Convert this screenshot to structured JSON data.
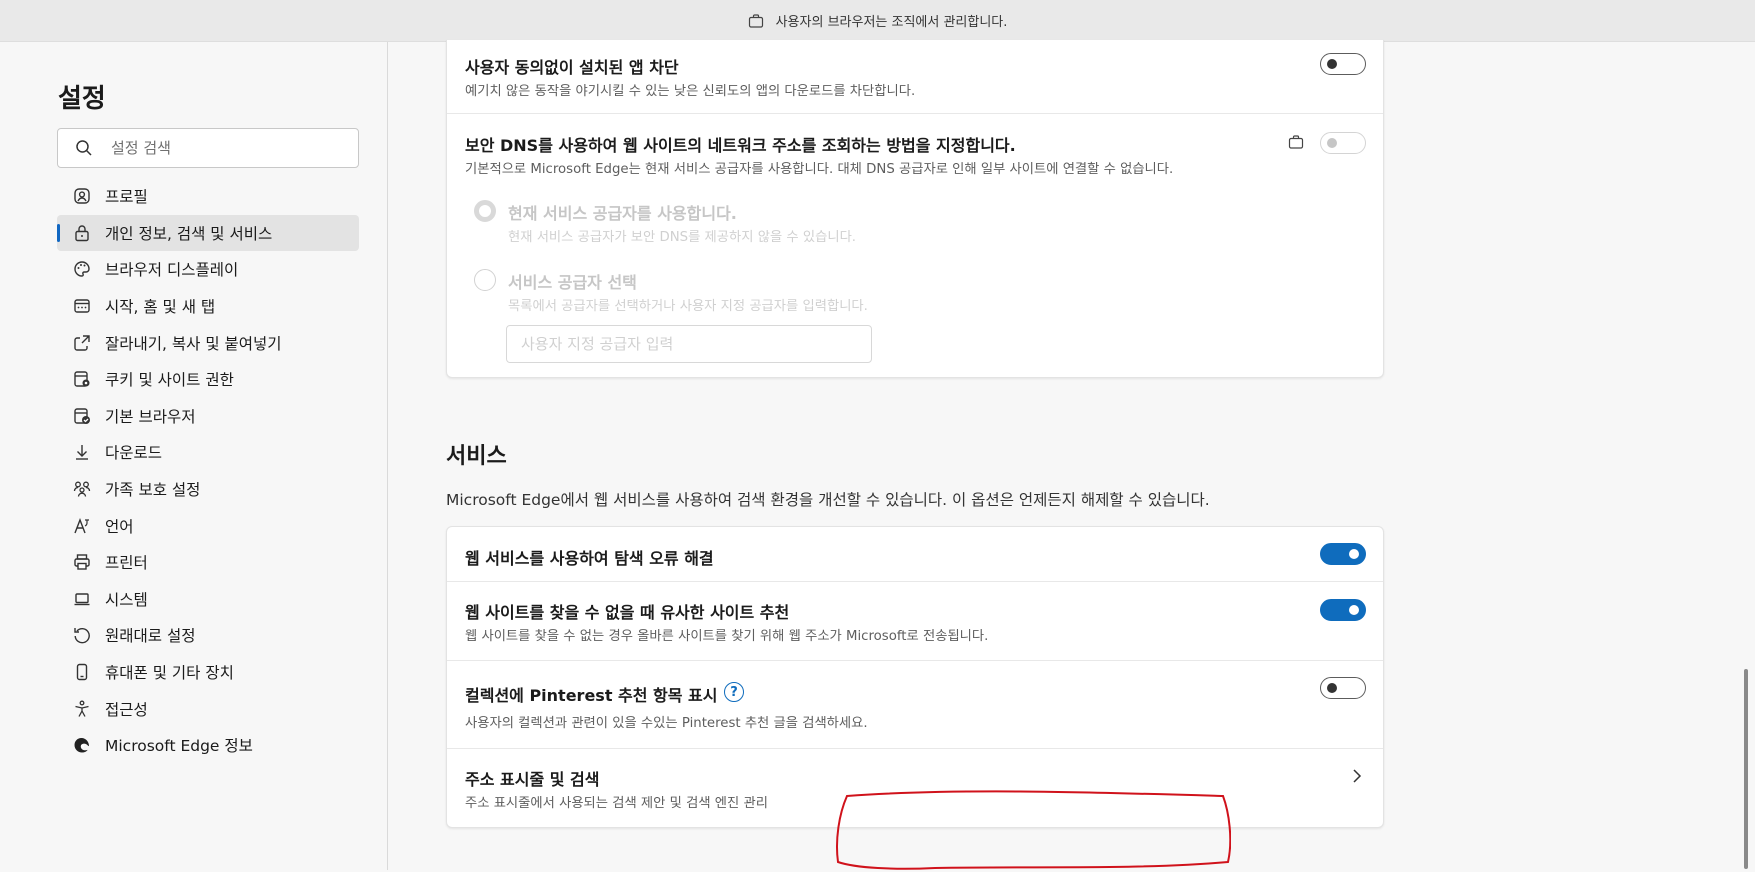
{
  "banner": {
    "text": "사용자의 브라우저는 조직에서 관리합니다.",
    "icon": "briefcase-icon"
  },
  "sidebar": {
    "title": "설정",
    "search_placeholder": "설정 검색",
    "items": [
      {
        "label": "프로필",
        "icon": "profile-icon",
        "active": false
      },
      {
        "label": "개인 정보, 검색 및 서비스",
        "icon": "lock-icon",
        "active": true
      },
      {
        "label": "브라우저 디스플레이",
        "icon": "palette-icon",
        "active": false
      },
      {
        "label": "시작, 홈 및 새 탭",
        "icon": "home-tab-icon",
        "active": false
      },
      {
        "label": "잘라내기, 복사 및 붙여넣기",
        "icon": "share-icon",
        "active": false
      },
      {
        "label": "쿠키 및 사이트 권한",
        "icon": "cookie-site-icon",
        "active": false
      },
      {
        "label": "기본 브라우저",
        "icon": "default-browser-icon",
        "active": false
      },
      {
        "label": "다운로드",
        "icon": "download-icon",
        "active": false
      },
      {
        "label": "가족 보호 설정",
        "icon": "family-icon",
        "active": false
      },
      {
        "label": "언어",
        "icon": "language-icon",
        "active": false
      },
      {
        "label": "프린터",
        "icon": "printer-icon",
        "active": false
      },
      {
        "label": "시스템",
        "icon": "laptop-icon",
        "active": false
      },
      {
        "label": "원래대로 설정",
        "icon": "reset-icon",
        "active": false
      },
      {
        "label": "휴대폰 및 기타 장치",
        "icon": "phone-icon",
        "active": false
      },
      {
        "label": "접근성",
        "icon": "accessibility-icon",
        "active": false
      },
      {
        "label": "Microsoft Edge 정보",
        "icon": "edge-logo-icon",
        "active": false
      }
    ]
  },
  "security": {
    "pua": {
      "title": "사용자 동의없이 설치된 앱 차단",
      "desc": "예기치 않은 동작을 야기시킬 수 있는 낮은 신뢰도의 앱의 다운로드를 차단합니다.",
      "toggle": "off"
    },
    "dns": {
      "title": "보안 DNS를 사용하여 웹 사이트의 네트워크 주소를 조회하는 방법을 지정합니다.",
      "desc": "기본적으로 Microsoft Edge는 현재 서비스 공급자를 사용합니다. 대체 DNS 공급자로 인해 일부 사이트에 연결할 수 없습니다.",
      "toggle": "off-disabled",
      "managed_icon": "briefcase-icon",
      "option_current": {
        "title": "현재 서비스 공급자를 사용합니다.",
        "desc": "현재 서비스 공급자가 보안 DNS를 제공하지 않을 수 있습니다.",
        "checked": true
      },
      "option_choose": {
        "title": "서비스 공급자 선택",
        "desc": "목록에서 공급자를 선택하거나 사용자 지정 공급자를 입력합니다.",
        "checked": false
      },
      "custom_placeholder": "사용자 지정 공급자 입력"
    }
  },
  "services": {
    "title": "서비스",
    "desc": "Microsoft Edge에서 웹 서비스를 사용하여 검색 환경을 개선할 수 있습니다. 이 옵션은 언제든지 해제할 수 있습니다.",
    "rows": {
      "nav_errors": {
        "title": "웹 서비스를 사용하여 탐색 오류 해결",
        "toggle": "on"
      },
      "similar_sites": {
        "title": "웹 사이트를 찾을 수 없을 때 유사한 사이트 추천",
        "desc": "웹 사이트를 찾을 수 없는 경우 올바른 사이트를 찾기 위해 웹 주소가 Microsoft로 전송됩니다.",
        "toggle": "on"
      },
      "pinterest": {
        "title": "컬렉션에 Pinterest 추천 항목 표시",
        "desc": "사용자의 컬렉션과 관련이 있을 수있는 Pinterest 추천 글을 검색하세요.",
        "help_glyph": "?",
        "toggle": "off"
      },
      "address_bar": {
        "title": "주소 표시줄 및 검색",
        "desc": "주소 표시줄에서 사용되는 검색 제안 및 검색 엔진 관리"
      }
    }
  },
  "colors": {
    "accent": "#0f6cbd",
    "annotation": "#d0121b"
  }
}
